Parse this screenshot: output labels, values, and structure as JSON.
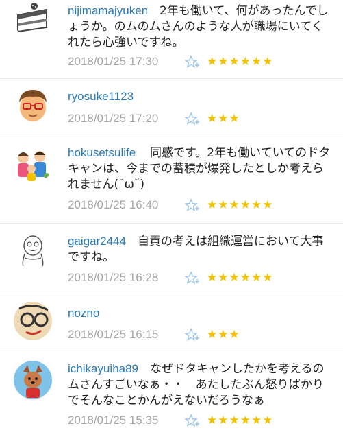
{
  "comments": [
    {
      "user": "nijimamajyuken",
      "text": "2年も働いて、何があったんでしょうか。のムのムさんのような人が職場にいてくれたら心強いですね。",
      "date": "2018/01/25 17:30",
      "stars": "★★★★★★",
      "avatar": "cake-avatar-icon"
    },
    {
      "user": "ryosuke1123",
      "text": "",
      "date": "2018/01/25 17:20",
      "stars": "★★★",
      "avatar": "boy-face-avatar-icon"
    },
    {
      "user": "hokusetsulife",
      "text": "同感です。2年も働いていてのドタキャンは、今までの蓄積が爆発したとしか考えられません(˘ω˘)",
      "date": "2018/01/25 16:40",
      "stars": "★★★★★★",
      "avatar": "family-avatar-icon"
    },
    {
      "user": "gaigar2444",
      "text": "自責の考えは組織運営において大事ですね。",
      "date": "2018/01/25 16:28",
      "stars": "★★★★★★",
      "avatar": "sketch-character-avatar-icon"
    },
    {
      "user": "nozno",
      "text": "",
      "date": "2018/01/25 16:15",
      "stars": "★★★",
      "avatar": "glasses-face-avatar-icon"
    },
    {
      "user": "ichikayuiha89",
      "text": "なぜドタキャンしたかを考えるのムさんすごいなぁ・・　あたしたぶん怒りばかりでそんなことかんがえないだろうなぁ",
      "date": "2018/01/25 15:35",
      "stars": "★★★★★★",
      "avatar": "dog-avatar-icon"
    }
  ],
  "colors": {
    "username": "#2a7ab8",
    "date": "#a6a6a6",
    "star": "#f2c200",
    "like": "#9fc6e8",
    "divider": "#e6e6e6"
  }
}
